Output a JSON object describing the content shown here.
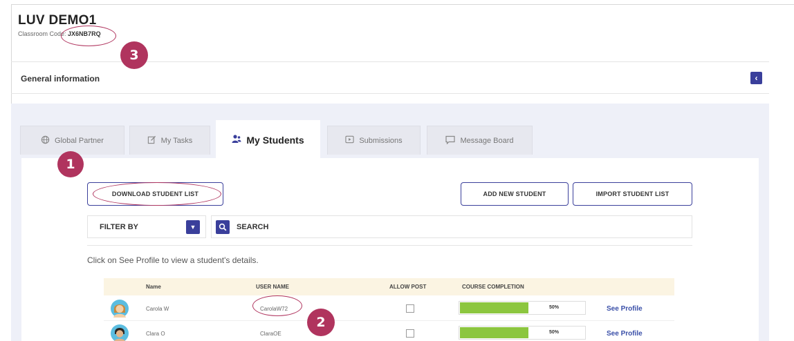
{
  "page": {
    "title": "LUV DEMO1",
    "classroom_code_label": "Classroom Code:",
    "classroom_code": "JX6NB7RQ"
  },
  "general_info": {
    "title": "General information",
    "collapse_icon": "chevron-left-icon"
  },
  "tabs": [
    {
      "label": "Global Partner",
      "icon": "globe-icon",
      "active": false
    },
    {
      "label": "My Tasks",
      "icon": "edit-icon",
      "active": false
    },
    {
      "label": "My Students",
      "icon": "students-icon",
      "active": true
    },
    {
      "label": "Submissions",
      "icon": "play-icon",
      "active": false
    },
    {
      "label": "Message Board",
      "icon": "chat-icon",
      "active": false
    }
  ],
  "actions": {
    "download": "DOWNLOAD STUDENT LIST",
    "add": "ADD NEW STUDENT",
    "import": "IMPORT STUDENT LIST"
  },
  "filter": {
    "label": "FILTER BY"
  },
  "search": {
    "label": "SEARCH"
  },
  "hint": "Click on See Profile to view a student's details.",
  "table": {
    "headers": [
      "Name",
      "USER NAME",
      "ALLOW POST",
      "COURSE COMPLETION"
    ],
    "rows": [
      {
        "name": "Carola W",
        "username": "CarolaW72",
        "allow_post": false,
        "completion": 0.5,
        "completion_label": "50%",
        "link": "See Profile"
      },
      {
        "name": "Clara O",
        "username": "ClaraOE",
        "allow_post": false,
        "completion": 0.5,
        "completion_label": "50%",
        "link": "See Profile"
      }
    ]
  },
  "callouts": [
    "1",
    "2",
    "3"
  ],
  "colors": {
    "primary": "#3a3f9b",
    "callout": "#b0345e",
    "progress": "#8cc63f",
    "table_header": "#fbf4e2",
    "panel": "#eef0f8"
  }
}
